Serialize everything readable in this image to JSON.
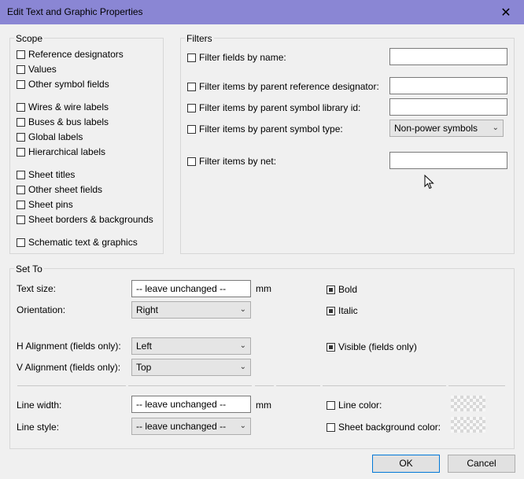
{
  "window": {
    "title": "Edit Text and Graphic Properties",
    "close_glyph": "✕"
  },
  "scope": {
    "label": "Scope",
    "items": [
      {
        "label": "Reference designators",
        "checked": false
      },
      {
        "label": "Values",
        "checked": false
      },
      {
        "label": "Other symbol fields",
        "checked": false
      },
      {
        "label": "Wires & wire labels",
        "checked": false
      },
      {
        "label": "Buses & bus labels",
        "checked": false
      },
      {
        "label": "Global labels",
        "checked": false
      },
      {
        "label": "Hierarchical labels",
        "checked": false
      },
      {
        "label": "Sheet titles",
        "checked": false
      },
      {
        "label": "Other sheet fields",
        "checked": false
      },
      {
        "label": "Sheet pins",
        "checked": false
      },
      {
        "label": "Sheet borders & backgrounds",
        "checked": false
      },
      {
        "label": "Schematic text & graphics",
        "checked": false
      }
    ]
  },
  "filters": {
    "label": "Filters",
    "by_name": {
      "label": "Filter fields by name:",
      "checked": false,
      "value": ""
    },
    "by_ref": {
      "label": "Filter items by parent reference designator:",
      "checked": false,
      "value": ""
    },
    "by_lib": {
      "label": "Filter items by parent symbol library id:",
      "checked": false,
      "value": ""
    },
    "by_type": {
      "label": "Filter items by parent symbol type:",
      "checked": false,
      "selected": "Non-power symbols"
    },
    "by_net": {
      "label": "Filter items by net:",
      "checked": false,
      "value": ""
    }
  },
  "set_to": {
    "label": "Set To",
    "text_size": {
      "label": "Text size:",
      "value": "-- leave unchanged --",
      "unit": "mm"
    },
    "orientation": {
      "label": "Orientation:",
      "selected": "Right"
    },
    "h_align": {
      "label": "H Alignment (fields only):",
      "selected": "Left"
    },
    "v_align": {
      "label": "V Alignment (fields only):",
      "selected": "Top"
    },
    "bold": {
      "label": "Bold",
      "checked": true
    },
    "italic": {
      "label": "Italic",
      "checked": true
    },
    "visible": {
      "label": "Visible (fields only)",
      "checked": true
    },
    "line_width": {
      "label": "Line width:",
      "value": "-- leave unchanged --",
      "unit": "mm"
    },
    "line_style": {
      "label": "Line style:",
      "selected": "-- leave unchanged --"
    },
    "line_color": {
      "label": "Line color:",
      "checked": false
    },
    "sheet_bg_color": {
      "label": "Sheet background color:",
      "checked": false
    }
  },
  "buttons": {
    "ok": "OK",
    "cancel": "Cancel"
  },
  "colors": {
    "titlebar": "#8a86d4",
    "accent": "#0078d7"
  }
}
